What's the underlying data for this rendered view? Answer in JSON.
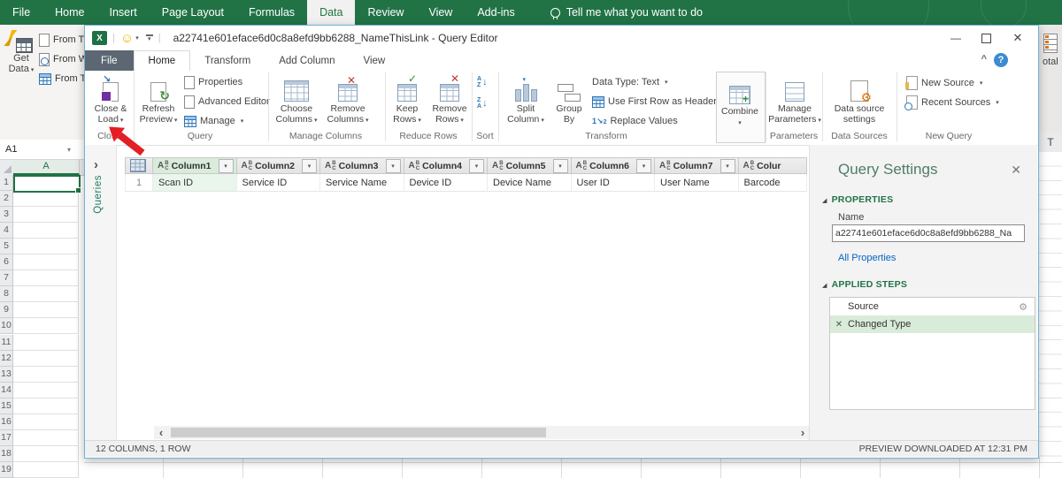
{
  "colors": {
    "excel_green": "#217346",
    "file_tab": "#5c6773",
    "selection_green": "#d9ecd9",
    "link_blue": "#0563c1",
    "help_blue": "#3b8bd0",
    "arrow_red": "#e31e24",
    "gear_orange": "#e2750e"
  },
  "glyphs": {
    "caret": "▾",
    "tri": "◢",
    "expand": "›",
    "scroll_left": "‹",
    "scroll_right": "›",
    "collapse": "^",
    "help": "?",
    "close": "✕",
    "min": "—",
    "check": "✓",
    "cross": "✕",
    "down": "↓",
    "refresh": "↻",
    "arrow_in": "↘",
    "one": "1",
    "two": "2",
    "a": "A",
    "b": "B",
    "c": "C",
    "z": "Z",
    "pipe": "|",
    "smiley": "☺",
    "gear": "⚙",
    "row1": "1"
  },
  "excel": {
    "tabs": [
      {
        "label": "File"
      },
      {
        "label": "Home"
      },
      {
        "label": "Insert"
      },
      {
        "label": "Page Layout"
      },
      {
        "label": "Formulas"
      },
      {
        "label": "Data",
        "selected": true
      },
      {
        "label": "Review"
      },
      {
        "label": "View"
      },
      {
        "label": "Add-ins"
      }
    ],
    "tell_me": "Tell me what you want to do",
    "get_data_l1": "Get",
    "get_data_l2": "Data",
    "from_text": "From T",
    "from_web": "From W",
    "from_table": "From T",
    "name_box": "A1",
    "col_a": "A",
    "col_t": "T",
    "right_fragment": "otal",
    "rows": [
      1,
      2,
      3,
      4,
      5,
      6,
      7,
      8,
      9,
      10,
      11,
      12,
      13,
      14,
      15,
      16,
      17,
      18,
      19
    ]
  },
  "qe": {
    "title": "a22741e601eface6d0c8a8efd9bb6288_NameThisLink - Query Editor",
    "tabs": [
      {
        "label": "File",
        "file": true
      },
      {
        "label": "Home",
        "selected": true
      },
      {
        "label": "Transform"
      },
      {
        "label": "Add Column"
      },
      {
        "label": "View"
      }
    ],
    "ribbon": {
      "close": {
        "label": "Close",
        "close_load": {
          "l1": "Close &",
          "l2": "Load"
        }
      },
      "query": {
        "label": "Query",
        "refresh": {
          "l1": "Refresh",
          "l2": "Preview"
        },
        "properties": "Properties",
        "advanced": "Advanced Editor",
        "manage": "Manage"
      },
      "manage_columns": {
        "label": "Manage Columns",
        "choose": {
          "l1": "Choose",
          "l2": "Columns"
        },
        "remove": {
          "l1": "Remove",
          "l2": "Columns"
        }
      },
      "reduce_rows": {
        "label": "Reduce Rows",
        "keep": {
          "l1": "Keep",
          "l2": "Rows"
        },
        "remove": {
          "l1": "Remove",
          "l2": "Rows"
        }
      },
      "sort": {
        "label": "Sort"
      },
      "transform": {
        "label": "Transform",
        "split": {
          "l1": "Split",
          "l2": "Column"
        },
        "group_by": {
          "l1": "Group",
          "l2": "By"
        },
        "data_type": "Data Type: Text",
        "first_row": "Use First Row as Headers",
        "replace": "Replace Values"
      },
      "combine": {
        "label": "Combine"
      },
      "parameters": {
        "label": "Parameters",
        "manage_parameters": {
          "l1": "Manage",
          "l2": "Parameters"
        }
      },
      "data_sources": {
        "label": "Data Sources",
        "settings": {
          "l1": "Data source",
          "l2": "settings"
        }
      },
      "new_query": {
        "label": "New Query",
        "new_source": "New Source",
        "recent_sources": "Recent Sources"
      }
    },
    "queries_pane": {
      "label": "Queries"
    },
    "table": {
      "row_number": "1",
      "columns": [
        {
          "name": "Column1",
          "value": "Scan ID",
          "selected": true
        },
        {
          "name": "Column2",
          "value": "Service ID"
        },
        {
          "name": "Column3",
          "value": "Service Name"
        },
        {
          "name": "Column4",
          "value": "Device ID"
        },
        {
          "name": "Column5",
          "value": "Device Name"
        },
        {
          "name": "Column6",
          "value": "User ID"
        },
        {
          "name": "Column7",
          "value": "User Name"
        },
        {
          "name": "Colur",
          "value": "Barcode",
          "clipped": true
        }
      ]
    },
    "query_settings": {
      "title": "Query Settings",
      "properties_header": "PROPERTIES",
      "name_label": "Name",
      "name_value": "a22741e601eface6d0c8a8efd9bb6288_Na",
      "all_properties": "All Properties",
      "applied_steps_header": "APPLIED STEPS",
      "steps": [
        {
          "label": "Source",
          "gear": true
        },
        {
          "label": "Changed Type",
          "selected": true,
          "removable": true
        }
      ]
    },
    "status": {
      "left": "12 COLUMNS, 1 ROW",
      "right": "PREVIEW DOWNLOADED AT 12:31 PM"
    }
  }
}
